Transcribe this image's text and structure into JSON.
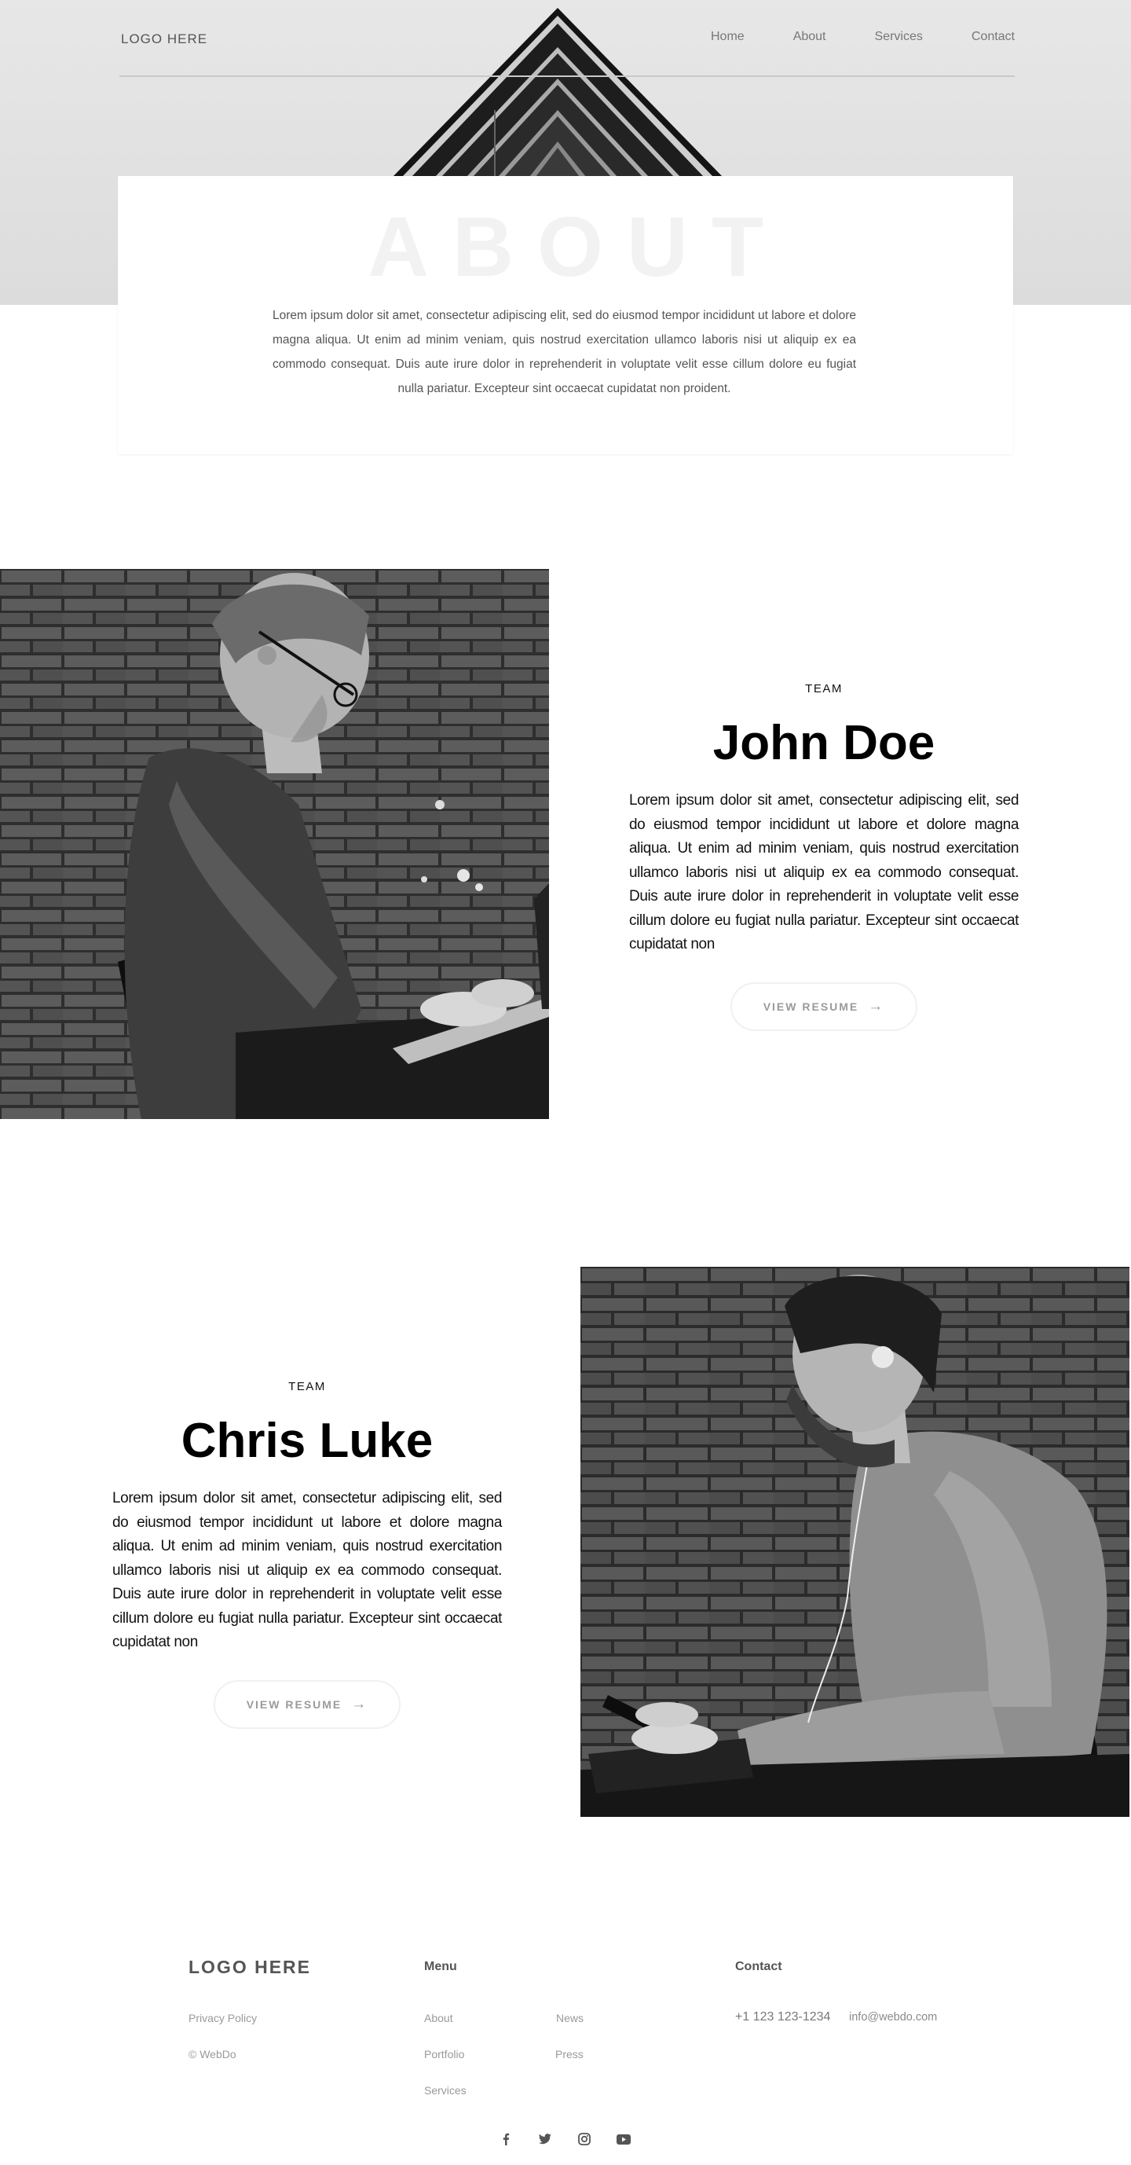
{
  "header": {
    "logo": "LOGO HERE",
    "nav": [
      "Home",
      "About",
      "Services",
      "Contact"
    ]
  },
  "about": {
    "title": "ABOUT",
    "text": "Lorem ipsum dolor sit amet, consectetur adipiscing elit, sed do eiusmod tempor incididunt ut labore et dolore magna aliqua. Ut enim ad minim veniam, quis nostrud exercitation ullamco laboris nisi ut aliquip ex ea commodo consequat. Duis aute irure dolor in reprehenderit in voluptate velit esse cillum dolore eu fugiat nulla pariatur. Excepteur sint occaecat cupidatat non proident."
  },
  "team": [
    {
      "label": "TEAM",
      "name": "John Doe",
      "bio": "Lorem ipsum dolor sit amet, consectetur adipiscing elit, sed do eiusmod tempor incididunt ut labore et dolore magna aliqua. Ut enim ad minim veniam, quis nostrud exercitation ullamco laboris nisi ut aliquip ex ea commodo consequat. Duis aute irure dolor in reprehenderit in voluptate velit esse cillum dolore eu fugiat nulla pariatur. Excepteur sint occaecat cupidatat non",
      "button": "VIEW RESUME"
    },
    {
      "label": "TEAM",
      "name": "Chris Luke",
      "bio": "Lorem ipsum dolor sit amet, consectetur adipiscing elit, sed do eiusmod tempor incididunt ut labore et dolore magna aliqua. Ut enim ad minim veniam, quis nostrud exercitation ullamco laboris nisi ut aliquip ex ea commodo consequat. Duis aute irure dolor in reprehenderit in voluptate velit esse cillum dolore eu fugiat nulla pariatur. Excepteur sint occaecat cupidatat non",
      "button": "VIEW RESUME"
    }
  ],
  "footer": {
    "logo": "LOGO HERE",
    "privacy": "Privacy Policy",
    "copyright": "© WebDo",
    "menu_heading": "Menu",
    "menu": [
      "About",
      "Portfolio",
      "Services",
      "News",
      "Press"
    ],
    "contact_heading": "Contact",
    "phone": "+1 123 123-1234",
    "email": "info@webdo.com",
    "socials": [
      "facebook-icon",
      "twitter-icon",
      "instagram-icon",
      "youtube-icon"
    ]
  },
  "colors": {
    "hero_bg": "#e1e1e1",
    "watermark": "#f2f2f2",
    "body_text": "#555555"
  }
}
